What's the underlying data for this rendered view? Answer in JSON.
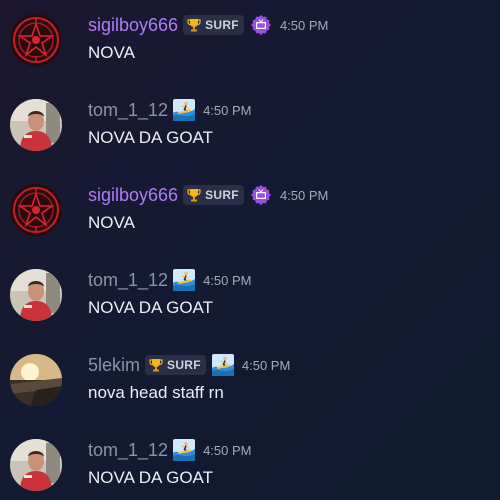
{
  "colors": {
    "username_purple": "#b07cf7",
    "username_gray": "#8a94a6",
    "tag_background": "#2a2f45",
    "message_text": "#eceff5",
    "timestamp": "#a3abba"
  },
  "messages": [
    {
      "username": "sigilboy666",
      "username_color": "purple",
      "avatar_icon": "red-sigil-emblem",
      "tag_icon": "trophy-icon",
      "tag_label": "SURF",
      "extra_badge_icon": "purple-tv-badge-icon",
      "timestamp": "4:50 PM",
      "text": "NOVA"
    },
    {
      "username": "tom_1_12",
      "username_color": "gray",
      "avatar_icon": "person-red-shirt-photo",
      "extra_badge_icon": "surfer-emoji-icon",
      "timestamp": "4:50 PM",
      "text": "NOVA DA GOAT"
    },
    {
      "username": "sigilboy666",
      "username_color": "purple",
      "avatar_icon": "red-sigil-emblem",
      "tag_icon": "trophy-icon",
      "tag_label": "SURF",
      "extra_badge_icon": "purple-tv-badge-icon",
      "timestamp": "4:50 PM",
      "text": "NOVA"
    },
    {
      "username": "tom_1_12",
      "username_color": "gray",
      "avatar_icon": "person-red-shirt-photo",
      "extra_badge_icon": "surfer-emoji-icon",
      "timestamp": "4:50 PM",
      "text": "NOVA DA GOAT"
    },
    {
      "username": "5lekim",
      "username_color": "gray",
      "avatar_icon": "sunset-landscape-photo",
      "tag_icon": "trophy-icon",
      "tag_label": "SURF",
      "extra_badge_icon": "surfer-emoji-icon",
      "timestamp": "4:50 PM",
      "text": "nova head staff rn"
    },
    {
      "username": "tom_1_12",
      "username_color": "gray",
      "avatar_icon": "person-red-shirt-photo",
      "extra_badge_icon": "surfer-emoji-icon",
      "timestamp": "4:50 PM",
      "text": "NOVA DA GOAT"
    }
  ]
}
